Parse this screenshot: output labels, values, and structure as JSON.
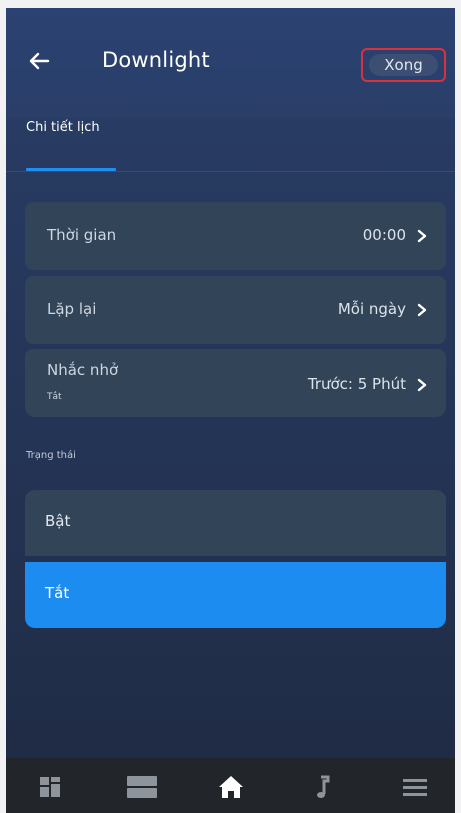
{
  "header": {
    "title": "Downlight",
    "done_label": "Xong"
  },
  "tabs": [
    {
      "label": "Chi tiết lịch"
    }
  ],
  "settings": [
    {
      "label": "Thời gian",
      "value": "00:00"
    },
    {
      "label": "Lặp lại",
      "value": "Mỗi ngày"
    },
    {
      "label": "Nhắc nhở",
      "sub": "Tắt",
      "value": "Trước: 5 Phút"
    }
  ],
  "status": {
    "title": "Trạng thái",
    "options": [
      {
        "label": "Bật",
        "selected": false
      },
      {
        "label": "Tắt",
        "selected": true
      }
    ]
  },
  "bottom_nav": {
    "items": [
      "dashboard-icon",
      "devices-icon",
      "home-icon",
      "music-icon",
      "menu-icon"
    ],
    "active": "home-icon"
  },
  "colors": {
    "accent": "#1c8cf0",
    "highlight_border": "#d8323d"
  }
}
